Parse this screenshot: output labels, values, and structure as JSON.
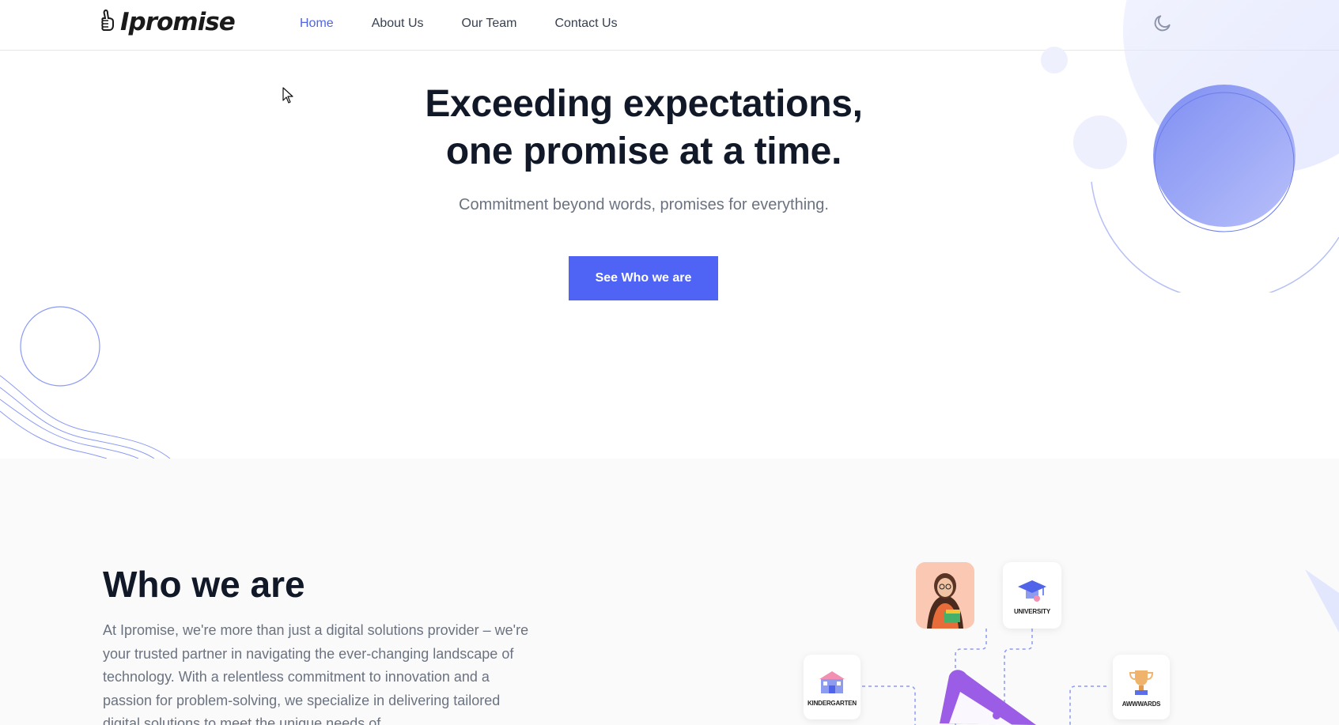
{
  "brand": {
    "name": "Ipromise"
  },
  "nav": {
    "items": [
      {
        "label": "Home",
        "active": true
      },
      {
        "label": "About Us",
        "active": false
      },
      {
        "label": "Our Team",
        "active": false
      },
      {
        "label": "Contact Us",
        "active": false
      }
    ],
    "theme_toggle_icon": "moon-icon"
  },
  "hero": {
    "title_line1": "Exceeding expectations,",
    "title_line2": "one promise at a time.",
    "subtitle": "Commitment beyond words, promises for everything.",
    "cta_label": "See Who we are"
  },
  "who": {
    "title": "Who we are",
    "text": "At Ipromise, we're more than just a digital solutions provider – we're your trusted partner in navigating the ever-changing landscape of technology. With a relentless commitment to innovation and a passion for problem-solving, we specialize in delivering tailored digital solutions to meet the unique needs of",
    "cards": [
      {
        "label": "UNIVERSITY",
        "icon": "graduation-cap-icon"
      },
      {
        "label": "KINDERGARTEN",
        "icon": "school-building-icon"
      },
      {
        "label": "AWWWARDS",
        "icon": "trophy-icon"
      }
    ],
    "person_icon": "person-avatar-icon",
    "megaphone_icon": "megaphone-icon"
  },
  "colors": {
    "accent": "#4f64f4",
    "nav_active": "#4f64e8",
    "text_dark": "#111827",
    "text_muted": "#6b7280",
    "section_bg": "#fafafa",
    "deco_blue": "#8b9af5"
  }
}
